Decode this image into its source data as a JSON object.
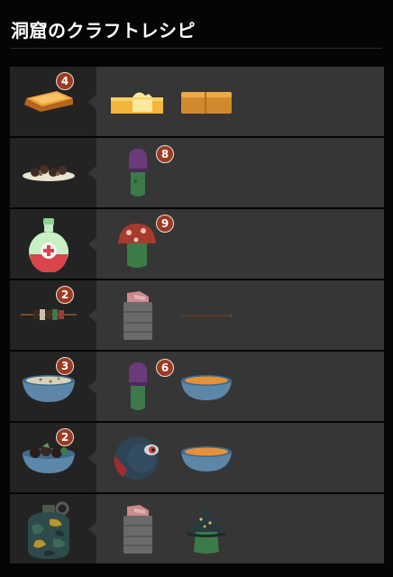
{
  "page": {
    "title": "洞窟のクラフトレシピ"
  },
  "recipes": [
    {
      "result": {
        "name": "toast-icon",
        "count": "4"
      },
      "ingredients": [
        {
          "name": "butter-icon",
          "count": ""
        },
        {
          "name": "bread-loaf-icon",
          "count": ""
        }
      ]
    },
    {
      "result": {
        "name": "meat-plate-icon",
        "count": ""
      },
      "ingredients": [
        {
          "name": "purple-mushroom-icon",
          "count": "8"
        }
      ]
    },
    {
      "result": {
        "name": "health-potion-icon",
        "count": ""
      },
      "ingredients": [
        {
          "name": "red-mushroom-icon",
          "count": "9"
        }
      ]
    },
    {
      "result": {
        "name": "kebab-skewer-icon",
        "count": "2"
      },
      "ingredients": [
        {
          "name": "raw-meat-can-icon",
          "count": ""
        },
        {
          "name": "wooden-stick-icon",
          "count": ""
        }
      ]
    },
    {
      "result": {
        "name": "mushroom-soup-icon",
        "count": "3"
      },
      "ingredients": [
        {
          "name": "purple-mushroom-icon",
          "count": "6"
        },
        {
          "name": "soup-bowl-icon",
          "count": ""
        }
      ]
    },
    {
      "result": {
        "name": "meat-stew-icon",
        "count": "2"
      },
      "ingredients": [
        {
          "name": "eyeball-meat-icon",
          "count": ""
        },
        {
          "name": "soup-bowl-icon",
          "count": ""
        }
      ]
    },
    {
      "result": {
        "name": "camo-grenade-icon",
        "count": ""
      },
      "ingredients": [
        {
          "name": "raw-meat-can-icon",
          "count": ""
        },
        {
          "name": "witch-hat-creature-icon",
          "count": ""
        }
      ]
    }
  ]
}
